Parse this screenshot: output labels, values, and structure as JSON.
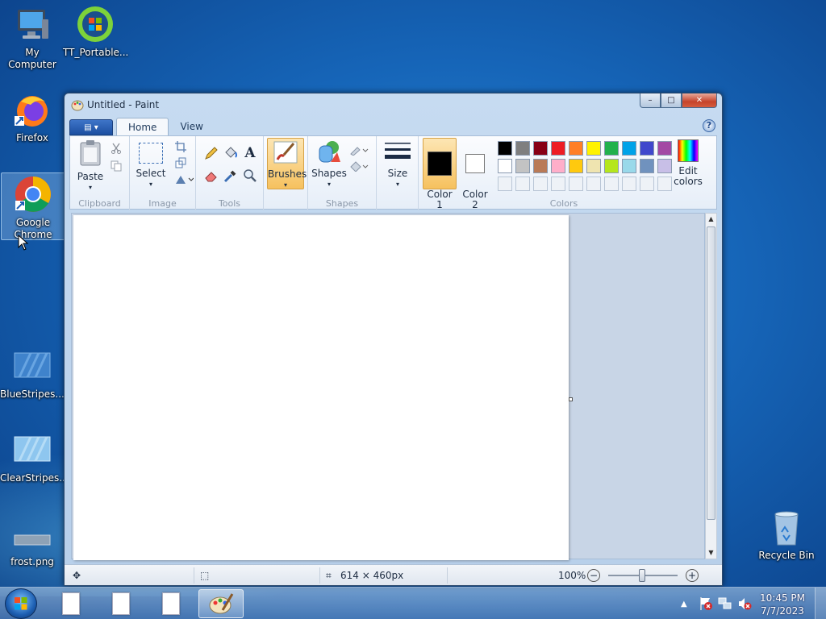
{
  "desktop": {
    "icons": [
      {
        "label": "My Computer"
      },
      {
        "label": "TT_Portable..."
      },
      {
        "label": "Firefox"
      },
      {
        "label": "Google Chrome"
      },
      {
        "label": "BlueStripes...."
      },
      {
        "label": "ClearStripes...."
      },
      {
        "label": "frost.png"
      },
      {
        "label": "Recycle Bin"
      }
    ]
  },
  "window": {
    "title": "Untitled - Paint",
    "controls": {
      "minimize": "–",
      "maximize": "□",
      "close": "✕"
    }
  },
  "ribbon": {
    "tabs": [
      {
        "label": "Home",
        "active": true
      },
      {
        "label": "View",
        "active": false
      }
    ],
    "help": "?",
    "groups": {
      "clipboard": {
        "label": "Clipboard",
        "paste": "Paste"
      },
      "image": {
        "label": "Image",
        "select": "Select"
      },
      "tools": {
        "label": "Tools"
      },
      "brushes": {
        "label": "Brushes"
      },
      "shapes": {
        "label": "Shapes",
        "shapes": "Shapes"
      },
      "size": {
        "label": "Size"
      },
      "colors": {
        "label": "Colors",
        "color1": "Color\n1",
        "color2": "Color\n2",
        "color1_value": "#000000",
        "color2_value": "#ffffff",
        "edit": "Edit colors",
        "row1": [
          "#000000",
          "#7f7f7f",
          "#880015",
          "#ed1c24",
          "#ff7f27",
          "#fff200",
          "#22b14c",
          "#00a2e8",
          "#3f48cc",
          "#a349a4"
        ],
        "row2": [
          "#ffffff",
          "#c3c3c3",
          "#b97a57",
          "#ffaec9",
          "#ffc90e",
          "#efe4b0",
          "#b5e61d",
          "#99d9ea",
          "#7092be",
          "#c8bfe7"
        ]
      }
    }
  },
  "statusbar": {
    "dimensions": "614 × 460px",
    "zoom": "100%",
    "zoom_out": "−",
    "zoom_in": "+"
  },
  "taskbar": {
    "time": "10:45 PM",
    "date": "7/7/2023"
  }
}
